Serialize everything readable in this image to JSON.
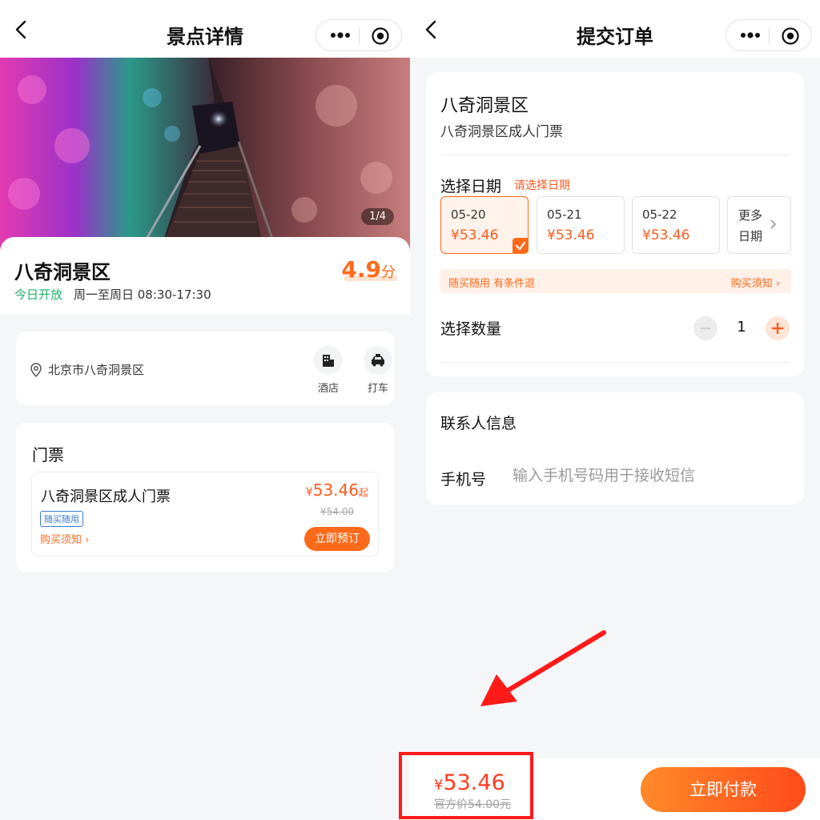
{
  "left": {
    "nav_title": "景点详情",
    "image_counter": "1/4",
    "spot_name": "八奇洞景区",
    "rating": {
      "score": "4.9",
      "unit": "分"
    },
    "open_status": "今日开放",
    "open_hours": "周一至周日 08:30-17:30",
    "address": "北京市八奇洞景区",
    "services": [
      {
        "label": "酒店",
        "icon": "hotel-icon"
      },
      {
        "label": "打车",
        "icon": "taxi-icon"
      }
    ],
    "tickets_section_title": "门票",
    "ticket": {
      "name": "八奇洞景区成人门票",
      "tag": "随买随用",
      "notice_label": "购买须知",
      "price_symbol": "¥",
      "price": "53.46",
      "price_suffix": "起",
      "original_price": "¥54.00",
      "book_button": "立即预订"
    }
  },
  "right": {
    "nav_title": "提交订单",
    "spot_name": "八奇洞景区",
    "ticket_name": "八奇洞景区成人门票",
    "date_title": "选择日期",
    "date_hint": "请选择日期",
    "dates": [
      {
        "date": "05-20",
        "price": "¥53.46",
        "selected": true
      },
      {
        "date": "05-21",
        "price": "¥53.46",
        "selected": false
      },
      {
        "date": "05-22",
        "price": "¥53.46",
        "selected": false
      }
    ],
    "more_dates": {
      "line1": "更多",
      "line2": "日期"
    },
    "refund_policy": "随买随用 有条件退",
    "purchase_notice": "购买须知",
    "quantity_title": "选择数量",
    "quantity": "1",
    "contact_title": "联系人信息",
    "phone_label": "手机号",
    "phone_placeholder": "输入手机号码用于接收短信",
    "phone_value": "",
    "total": {
      "symbol": "¥",
      "amount": "53.46",
      "official_price": "官方价54.00元"
    },
    "pay_button": "立即付款"
  },
  "colors": {
    "accent": "#ff6a1a",
    "price": "#ff5a1f",
    "open_green": "#1eb36a",
    "annotation_red": "#ff1a1a"
  }
}
